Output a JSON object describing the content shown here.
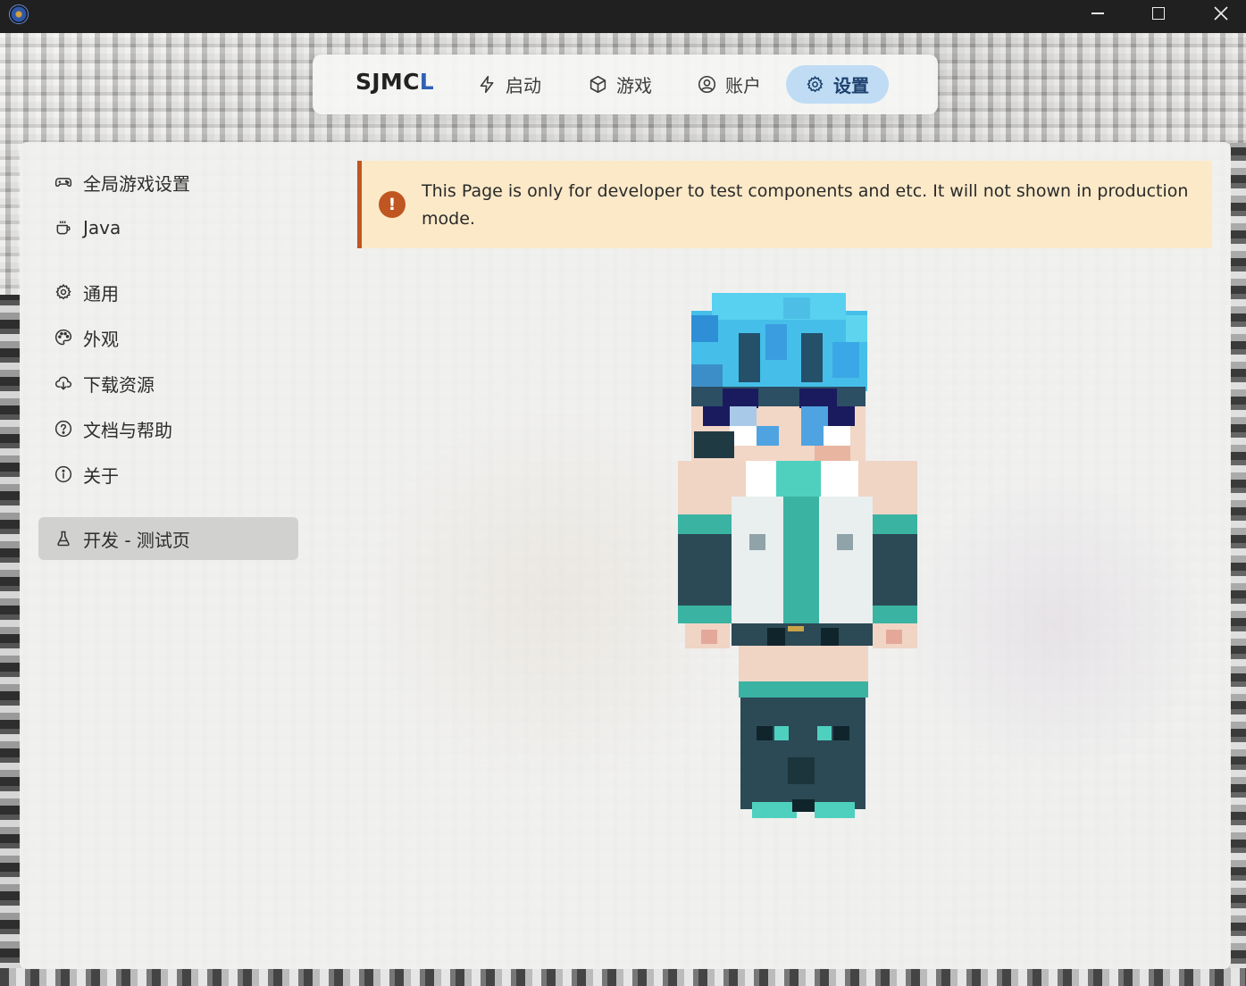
{
  "nav": {
    "brand_main": "SJMC",
    "brand_accent": "L",
    "items": [
      {
        "label": "启动",
        "icon": "lightning-icon"
      },
      {
        "label": "游戏",
        "icon": "cube-icon"
      },
      {
        "label": "账户",
        "icon": "user-circle-icon"
      },
      {
        "label": "设置",
        "icon": "gear-icon",
        "active": true
      }
    ]
  },
  "sidebar": {
    "items": [
      {
        "label": "全局游戏设置",
        "icon": "gamepad-icon"
      },
      {
        "label": "Java",
        "icon": "coffee-cup-icon"
      },
      {
        "label": "通用",
        "icon": "gear-icon"
      },
      {
        "label": "外观",
        "icon": "palette-icon"
      },
      {
        "label": "下载资源",
        "icon": "cloud-download-icon"
      },
      {
        "label": "文档与帮助",
        "icon": "help-circle-icon"
      },
      {
        "label": "关于",
        "icon": "info-circle-icon"
      },
      {
        "label": "开发 - 测试页",
        "icon": "flask-icon",
        "active": true
      }
    ]
  },
  "alert": {
    "text": "This Page is only for developer to test components and etc. It will not shown in production mode.",
    "icon": "warning-circle-icon",
    "color": "#c05621"
  },
  "colors": {
    "accent": "#2f61b5",
    "active_nav_bg": "#bfdcf4",
    "alert_bg": "#fbe9c8"
  }
}
